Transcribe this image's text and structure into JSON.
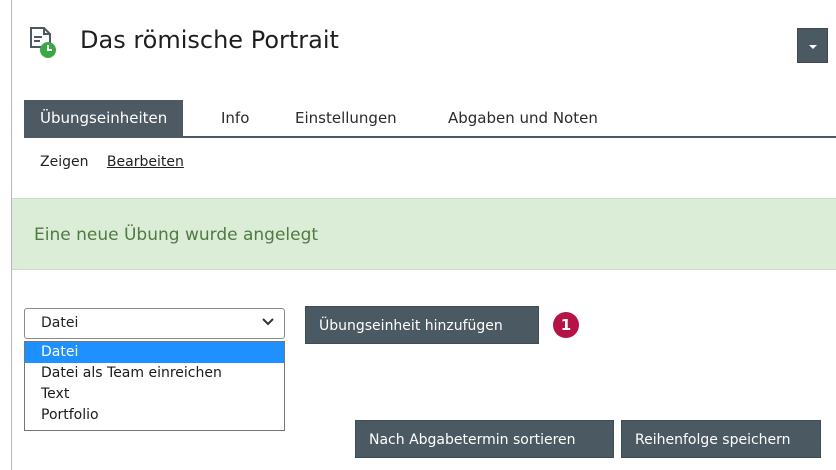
{
  "header": {
    "title": "Das römische Portrait",
    "icon": "exercise-clock-icon",
    "actions_icon": "caret-down-icon"
  },
  "tabs": [
    {
      "label": "Übungseinheiten",
      "active": true
    },
    {
      "label": "Info"
    },
    {
      "label": "Einstellungen"
    },
    {
      "label": "Abgaben und Noten"
    }
  ],
  "subtabs": [
    {
      "label": "Zeigen"
    },
    {
      "label": "Bearbeiten",
      "active": true
    }
  ],
  "message": {
    "text": "Eine neue Übung wurde angelegt",
    "color": "#4f7a43",
    "background": "#dcedd7"
  },
  "type_select": {
    "value": "Datei",
    "options": [
      "Datei",
      "Datei als Team einreichen",
      "Text",
      "Portfolio"
    ],
    "highlighted": "Datei"
  },
  "buttons": {
    "add": "Übungseinheit hinzufügen",
    "sort": "Nach Abgabetermin sortieren",
    "save_order": "Reihenfolge speichern"
  },
  "callout": {
    "number": "1",
    "color": "#b51344"
  },
  "colors": {
    "primary": "#4b5962",
    "select_highlight": "#1e90ff"
  }
}
